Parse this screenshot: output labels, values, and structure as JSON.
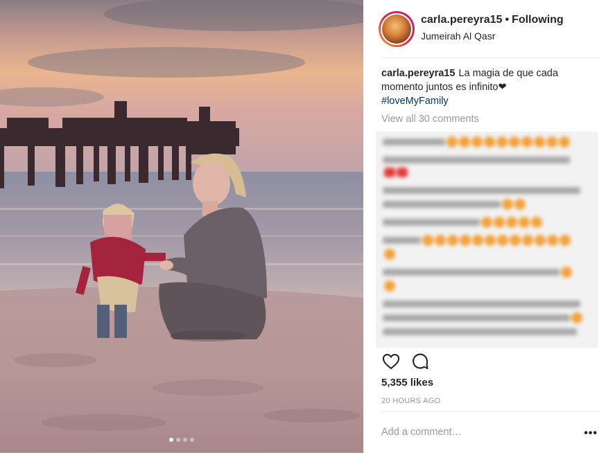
{
  "post": {
    "username": "carla.pereyra15",
    "separator": "•",
    "follow_status": "Following",
    "location": "Jumeirah Al Qasr"
  },
  "caption": {
    "username": "carla.pereyra15",
    "text": "La magia de que cada momento juntos es infinito❤",
    "hashtag": "#loveMyFamily"
  },
  "comments": {
    "view_all": "View all 30 comments"
  },
  "actions": {
    "like_icon": "heart-outline-icon",
    "comment_icon": "speech-bubble-icon"
  },
  "stats": {
    "likes": "5,355 likes",
    "time": "20 HOURS AGO"
  },
  "composer": {
    "placeholder": "Add a comment…",
    "more": "•••"
  },
  "carousel": {
    "slides": 4,
    "active_slide": 1
  },
  "colors": {
    "text": "#262626",
    "muted": "#999999",
    "hashtag": "#003569"
  }
}
